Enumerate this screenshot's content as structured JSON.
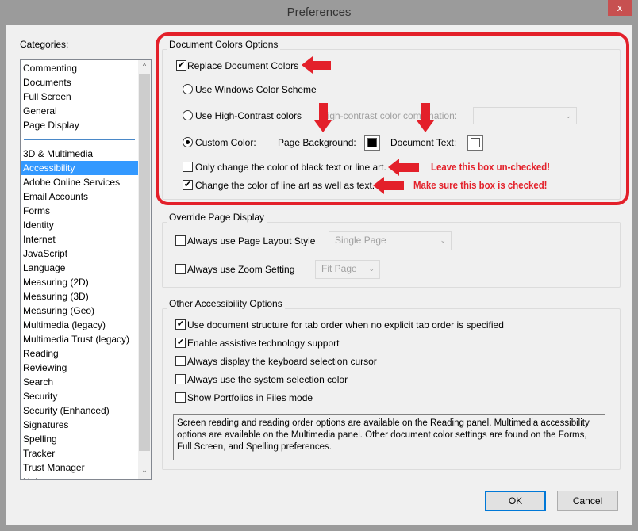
{
  "window": {
    "title": "Preferences",
    "close_label": "x"
  },
  "categories": {
    "label": "Categories:",
    "group1": [
      "Commenting",
      "Documents",
      "Full Screen",
      "General",
      "Page Display"
    ],
    "group2": [
      "3D & Multimedia",
      "Accessibility",
      "Adobe Online Services",
      "Email Accounts",
      "Forms",
      "Identity",
      "Internet",
      "JavaScript",
      "Language",
      "Measuring (2D)",
      "Measuring (3D)",
      "Measuring (Geo)",
      "Multimedia (legacy)",
      "Multimedia Trust (legacy)",
      "Reading",
      "Reviewing",
      "Search",
      "Security",
      "Security (Enhanced)",
      "Signatures",
      "Spelling",
      "Tracker",
      "Trust Manager",
      "Units"
    ],
    "selected": "Accessibility"
  },
  "document_colors": {
    "legend": "Document Colors Options",
    "replace": {
      "label": "Replace Document Colors",
      "checked": true
    },
    "windows_scheme": {
      "label": "Use Windows Color Scheme",
      "selected": false
    },
    "high_contrast": {
      "label": "Use High-Contrast colors",
      "selected": false,
      "combo_label": "High-contrast color combination:",
      "combo_value": ""
    },
    "custom": {
      "label": "Custom Color:",
      "selected": true,
      "page_bg_label": "Page Background:",
      "page_bg_color": "#000000",
      "doc_text_label": "Document Text:",
      "doc_text_color": "#ffffff"
    },
    "only_black": {
      "label": "Only change the color of black text or line art.",
      "checked": false
    },
    "line_art": {
      "label": "Change the color of line art as well as text.",
      "checked": true
    }
  },
  "annotations": {
    "color": "#e3202a",
    "leave_unchecked": "Leave this box un-checked!",
    "make_sure_checked": "Make sure this box is checked!"
  },
  "override": {
    "legend": "Override Page Display",
    "layout": {
      "label": "Always use Page Layout Style",
      "checked": false,
      "value": "Single Page"
    },
    "zoom": {
      "label": "Always use Zoom Setting",
      "checked": false,
      "value": "Fit Page"
    }
  },
  "other": {
    "legend": "Other Accessibility Options",
    "options": [
      {
        "label": "Use document structure for tab order when no explicit tab order is specified",
        "checked": true
      },
      {
        "label": "Enable assistive technology support",
        "checked": true
      },
      {
        "label": "Always display the keyboard selection cursor",
        "checked": false
      },
      {
        "label": "Always use the system selection color",
        "checked": false
      },
      {
        "label": "Show Portfolios in Files mode",
        "checked": false
      }
    ],
    "info": "Screen reading and reading order options are available on the Reading panel. Multimedia accessibility options are available on the Multimedia panel. Other document color settings are found on the Forms, Full Screen, and Spelling preferences."
  },
  "buttons": {
    "ok": "OK",
    "cancel": "Cancel"
  }
}
